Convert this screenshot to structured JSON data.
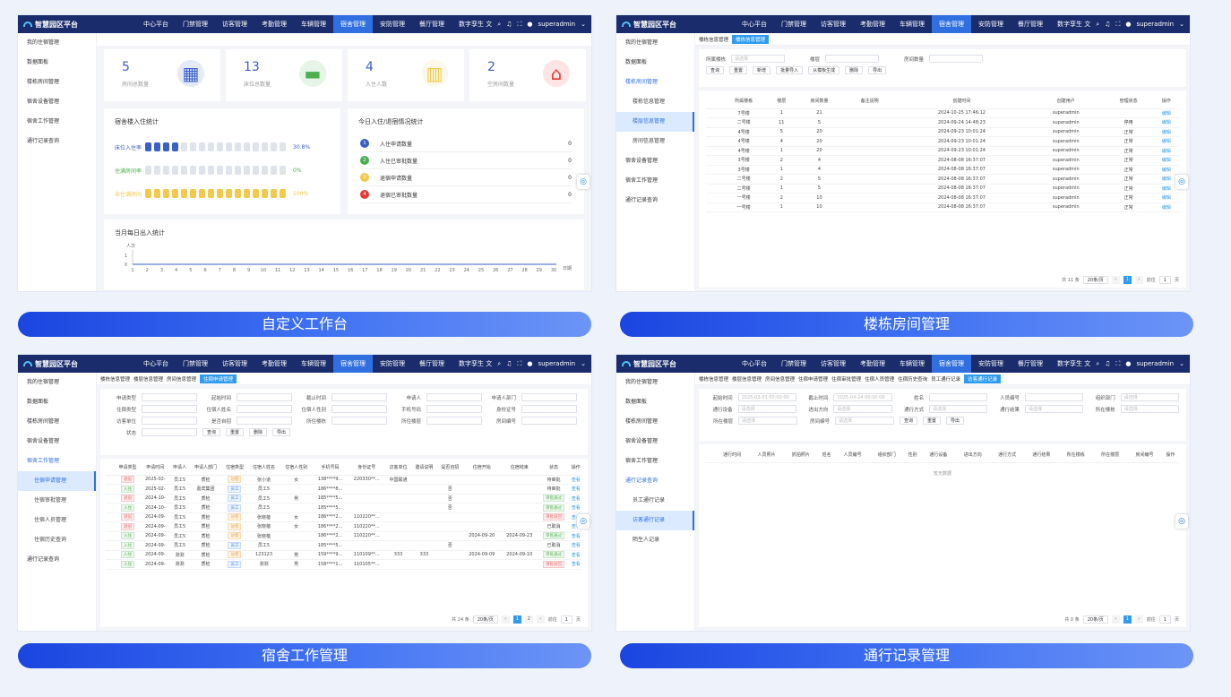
{
  "app_title": "智慧园区平台",
  "nav": [
    "中心平台",
    "门禁管理",
    "访客管理",
    "考勤管理",
    "车辆管理",
    "宿舍管理",
    "安防管理",
    "餐厅管理",
    "数字孪生"
  ],
  "nav_active": "宿舍管理",
  "user": "superadmin",
  "side1": [
    "我的住宿管理",
    "数据面板",
    "楼栋房间管理",
    "宿舍设备管理",
    "宿舍工作管理",
    "通行记录查询"
  ],
  "captions": [
    "自定义工作台",
    "楼栋房间管理",
    "宿舍工作管理",
    "通行记录管理"
  ],
  "p1": {
    "stats": [
      {
        "value": "5",
        "label": "房间总数量"
      },
      {
        "value": "13",
        "label": "床位总数量"
      },
      {
        "value": "4",
        "label": "入住人数"
      },
      {
        "value": "2",
        "label": "空房间数量"
      }
    ],
    "occupancy_title": "宿舍楼入住统计",
    "bars": [
      {
        "label": "床位入住率",
        "pct": "30.8%",
        "fill": 4,
        "color": "#3a5fc8"
      },
      {
        "label": "住满房间率",
        "pct": "0%",
        "fill": 0,
        "color": "#4caf50"
      },
      {
        "label": "未住满房间",
        "pct": "100%",
        "fill": 16,
        "color": "#f2c94c"
      }
    ],
    "today_title": "今日入住/退宿情况统计",
    "today": [
      {
        "n": "1",
        "label": "入住申请数量",
        "v": "0",
        "c": "#3a5fc8"
      },
      {
        "n": "2",
        "label": "入住已审批数量",
        "v": "0",
        "c": "#4caf50"
      },
      {
        "n": "3",
        "label": "退宿申请数量",
        "v": "0",
        "c": "#f2c94c"
      },
      {
        "n": "4",
        "label": "退宿已审批数量",
        "v": "0",
        "c": "#e53935"
      }
    ],
    "month_title": "当月每日出入统计",
    "ylabel": "人次",
    "xlabel": "日期",
    "x_ticks": [
      "1",
      "2",
      "3",
      "4",
      "5",
      "6",
      "7",
      "8",
      "9",
      "10",
      "11",
      "12",
      "13",
      "14",
      "15",
      "16",
      "17",
      "18",
      "19",
      "20",
      "21",
      "22",
      "23",
      "24",
      "25",
      "26",
      "27",
      "28",
      "29",
      "30"
    ],
    "y_ticks": [
      "1",
      "0"
    ]
  },
  "p2": {
    "tabs": [
      "楼栋信息管理",
      "楼栋信息管理"
    ],
    "side": [
      "我的住宿管理",
      "数据面板",
      "楼栋房间管理",
      "楼栋信息管理",
      "楼层信息管理",
      "房间信息管理",
      "宿舍设备管理",
      "宿舍工作管理",
      "通行记录查询"
    ],
    "filters": [
      {
        "label": "所属楼栋",
        "ph": "请选择"
      },
      {
        "label": "楼层",
        "ph": ""
      },
      {
        "label": "房间数量",
        "ph": ""
      }
    ],
    "buttons": [
      "查询",
      "重置",
      "新增",
      "批量导入",
      "从模板生成",
      "删除",
      "导出"
    ],
    "headers": [
      "所属楼栋",
      "楼层",
      "房间数量",
      "备注说明",
      "创建时间",
      "创建用户",
      "管理状态",
      "操作"
    ],
    "rows": [
      [
        "7号楼",
        "1",
        "21",
        "",
        "2024-10-25 17:46:12",
        "superadmin",
        "",
        "编辑"
      ],
      [
        "二号楼",
        "11",
        "5",
        "",
        "2024-09-24 14:48:23",
        "superadmin",
        "停用",
        "编辑"
      ],
      [
        "4号楼",
        "5",
        "20",
        "",
        "2024-09-23 10:01:24",
        "superadmin",
        "正常",
        "编辑"
      ],
      [
        "4号楼",
        "4",
        "20",
        "",
        "2024-09-23 10:01:24",
        "superadmin",
        "正常",
        "编辑"
      ],
      [
        "4号楼",
        "1",
        "20",
        "",
        "2024-09-23 10:01:24",
        "superadmin",
        "正常",
        "编辑"
      ],
      [
        "3号楼",
        "2",
        "4",
        "",
        "2024-08-08 16:37:07",
        "superadmin",
        "正常",
        "编辑"
      ],
      [
        "3号楼",
        "1",
        "4",
        "",
        "2024-08-08 16:37:07",
        "superadmin",
        "正常",
        "编辑"
      ],
      [
        "二号楼",
        "2",
        "5",
        "",
        "2024-08-08 16:37:07",
        "superadmin",
        "正常",
        "编辑"
      ],
      [
        "二号楼",
        "1",
        "5",
        "",
        "2024-08-08 16:37:07",
        "superadmin",
        "正常",
        "编辑"
      ],
      [
        "一号楼",
        "2",
        "10",
        "",
        "2024-08-08 16:37:07",
        "superadmin",
        "正常",
        "编辑"
      ],
      [
        "一号楼",
        "1",
        "10",
        "",
        "2024-08-08 16:37:07",
        "superadmin",
        "正常",
        "编辑"
      ]
    ],
    "total": "共 11 条",
    "page_size": "20条/页",
    "page": "1",
    "goto": "前往",
    "page_unit": "页"
  },
  "p3": {
    "tabs": [
      "楼栋信息管理",
      "楼层信息管理",
      "房间信息管理",
      "住宿申请管理"
    ],
    "side": [
      "我的住宿管理",
      "数据面板",
      "楼栋房间管理",
      "宿舍设备管理",
      "宿舍工作管理",
      "住宿申请管理",
      "住宿审批管理",
      "住宿人员管理",
      "住宿历史查询",
      "通行记录查询"
    ],
    "filters": [
      [
        "申请类型",
        "起始时间",
        "截止时间",
        "申请人",
        "申请人部门"
      ],
      [
        "住宿类型",
        "住宿人姓名",
        "住宿人性别",
        "手机号码",
        "身份证号"
      ],
      [
        "访客单位",
        "是否自招",
        "所住楼栋",
        "所住楼层",
        "房间编号"
      ],
      [
        "状态"
      ]
    ],
    "buttons": [
      "查询",
      "重置",
      "删除",
      "导出"
    ],
    "headers": [
      "申请类型",
      "申请时间",
      "申请人",
      "申请人部门",
      "住宿类型",
      "住宿人姓名",
      "住宿人性别",
      "手机号码",
      "身份证号",
      "访客单位",
      "邀请说明",
      "是否自招",
      "住宿开始",
      "住宿结束",
      "状态",
      "操作"
    ],
    "rows": [
      [
        "退宿",
        "2025-02-",
        "员工5",
        "质检",
        "访客",
        "张小道",
        "女",
        "138****9...",
        "220330**...",
        "中国联通",
        "",
        "",
        "",
        "",
        "待审批",
        "查看"
      ],
      [
        "入住",
        "2025-02-",
        "员工5",
        "嘉宾集团",
        "员工",
        "员工5",
        "",
        "186****8...",
        "",
        "",
        "",
        "否",
        "",
        "",
        "待审批",
        "查看"
      ],
      [
        "退宿",
        "2024-10-",
        "员工5",
        "质检",
        "员工",
        "员工5",
        "男",
        "185****5...",
        "",
        "",
        "",
        "否",
        "",
        "",
        "审批通过",
        "查看"
      ],
      [
        "入住",
        "2024-10-",
        "员工5",
        "质检",
        "员工",
        "员工5",
        "",
        "185****5...",
        "",
        "",
        "",
        "否",
        "",
        "",
        "审批通过",
        "查看"
      ],
      [
        "退宿",
        "2024-09-",
        "员工5",
        "质检",
        "访客",
        "张晓蓓",
        "女",
        "186****2...",
        "110220**...",
        "",
        "",
        "",
        "",
        "",
        "审批驳回",
        "查看"
      ],
      [
        "退宿",
        "2024-09-",
        "员工5",
        "质检",
        "访客",
        "张晓蓓",
        "女",
        "186****2...",
        "110220**...",
        "",
        "",
        "",
        "",
        "",
        "已取消",
        "查看"
      ],
      [
        "入住",
        "2024-09-",
        "员工5",
        "质检",
        "访客",
        "张晓蓓",
        "",
        "186****2...",
        "110220**...",
        "",
        "",
        "",
        "2024-09-20",
        "2024-09-23",
        "审批通过",
        "查看"
      ],
      [
        "入住",
        "2024-09-",
        "员工5",
        "质检",
        "员工",
        "员工5",
        "",
        "185****5...",
        "",
        "",
        "",
        "否",
        "",
        "",
        "已取消",
        "查看"
      ],
      [
        "入住",
        "2024-09-",
        "测测",
        "质检",
        "访客",
        "123123",
        "男",
        "159****9...",
        "110109**...",
        "333",
        "333",
        "",
        "2024-09-09",
        "2024-09-10",
        "审批通过",
        "查看"
      ],
      [
        "入住",
        "2024-09-",
        "测测",
        "质检",
        "员工",
        "测测",
        "男",
        "158****1...",
        "110105**...",
        "",
        "",
        "",
        "",
        "",
        "审批驳回",
        "查看"
      ]
    ],
    "total": "共 24 条",
    "page_size": "20条/页",
    "pages": [
      "1",
      "2"
    ],
    "goto": "前往",
    "page": "1",
    "page_unit": "页"
  },
  "p4": {
    "tabs": [
      "楼栋信息管理",
      "楼层信息管理",
      "房间信息管理",
      "住宿申请管理",
      "住宿审批管理",
      "住宿人员管理",
      "住宿历史查询",
      "员工通行记录",
      "访客通行记录"
    ],
    "side": [
      "我的住宿管理",
      "数据面板",
      "楼栋房间管理",
      "宿舍设备管理",
      "宿舍工作管理",
      "通行记录查询",
      "员工通行记录",
      "访客通行记录",
      "陌生人记录"
    ],
    "filters": [
      [
        [
          "起始时间",
          "2025-03-01 00:00:00"
        ],
        [
          "截止时间",
          "2025-04-24 00:00:00"
        ],
        [
          "姓名",
          ""
        ],
        [
          "人员编号",
          ""
        ],
        [
          "组织部门",
          "请选择"
        ]
      ],
      [
        [
          "通行设备",
          "请选择"
        ],
        [
          "进出方向",
          "请选择"
        ],
        [
          "通行方式",
          "请选择"
        ],
        [
          "通行结果",
          "请选择"
        ],
        [
          "所在楼栋",
          "请选择"
        ]
      ],
      [
        [
          "所在楼层",
          "请选择"
        ],
        [
          "房间编号",
          "请选择"
        ]
      ]
    ],
    "buttons": [
      "查询",
      "重置",
      "导出"
    ],
    "headers": [
      "通行时间",
      "人员照片",
      "抓拍照片",
      "姓名",
      "人员编号",
      "组织部门",
      "性别",
      "通行设备",
      "进出方向",
      "通行方式",
      "通行结果",
      "所在楼栋",
      "所在楼层",
      "房间编号",
      "操作"
    ],
    "empty": "暂无数据",
    "total": "共 0 条",
    "page_size": "20条/页",
    "page": "1",
    "goto": "前往",
    "page_unit": "页"
  }
}
